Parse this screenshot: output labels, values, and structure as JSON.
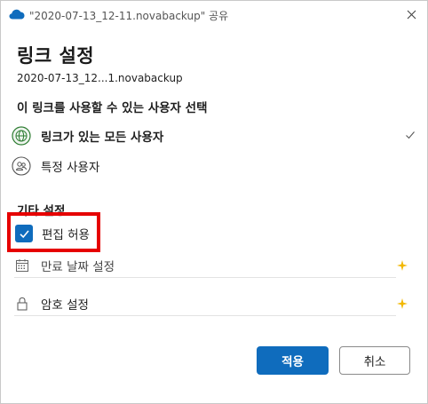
{
  "window": {
    "title": "\"2020-07-13_12-11.novabackup\" 공유",
    "app_icon": "onedrive-cloud-icon",
    "close_icon": "close-icon"
  },
  "dialog": {
    "heading": "링크 설정",
    "filename": "2020-07-13_12...1.novabackup",
    "audience_title": "이 링크를 사용할 수 있는 사용자 선택",
    "audience_options": [
      {
        "label": "링크가 있는 모든 사용자",
        "icon": "globe-icon",
        "selected": true
      },
      {
        "label": "특정 사용자",
        "icon": "people-icon",
        "selected": false
      }
    ],
    "other_settings_title": "기타 설정",
    "allow_edit": {
      "label": "편집 허용",
      "checked": true
    },
    "expiry": {
      "label": "만료 날짜 설정",
      "icon": "calendar-icon",
      "premium_icon": "sparkle-icon"
    },
    "password": {
      "label": "암호 설정",
      "icon": "lock-icon",
      "premium_icon": "sparkle-icon"
    },
    "buttons": {
      "apply": "적용",
      "cancel": "취소"
    }
  },
  "colors": {
    "accent": "#0f6cbd",
    "highlight_box": "#e60000",
    "sparkle": "#f2b800"
  }
}
